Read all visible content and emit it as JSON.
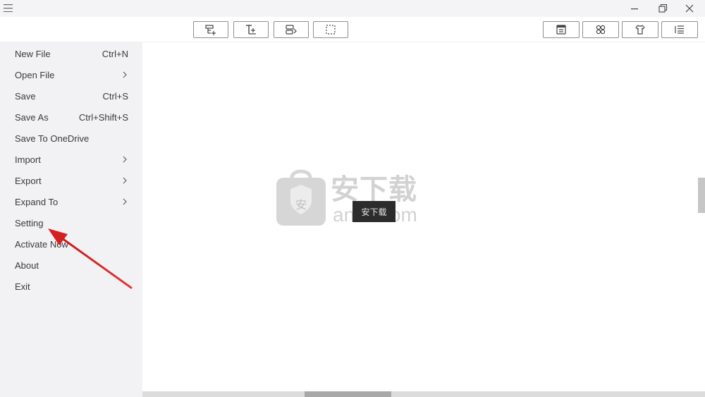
{
  "menu": {
    "items": [
      {
        "label": "New File",
        "shortcut": "Ctrl+N",
        "submenu": false
      },
      {
        "label": "Open File",
        "shortcut": "",
        "submenu": true
      },
      {
        "label": "Save",
        "shortcut": "Ctrl+S",
        "submenu": false
      },
      {
        "label": "Save As",
        "shortcut": "Ctrl+Shift+S",
        "submenu": false
      },
      {
        "label": "Save To OneDrive",
        "shortcut": "",
        "submenu": false
      },
      {
        "label": "Import",
        "shortcut": "",
        "submenu": true
      },
      {
        "label": "Export",
        "shortcut": "",
        "submenu": true
      },
      {
        "label": "Expand To",
        "shortcut": "",
        "submenu": true
      },
      {
        "label": "Setting",
        "shortcut": "",
        "submenu": false
      },
      {
        "label": "Activate Now",
        "shortcut": "",
        "submenu": false
      },
      {
        "label": "About",
        "shortcut": "",
        "submenu": false
      },
      {
        "label": "Exit",
        "shortcut": "",
        "submenu": false
      }
    ]
  },
  "toolbar": {
    "left_icons": [
      "add-subtopic-icon",
      "add-topic-icon",
      "add-note-icon",
      "select-area-icon"
    ],
    "right_icons": [
      "layout-icon",
      "style-icon",
      "theme-icon",
      "outline-icon"
    ]
  },
  "watermark": {
    "title": "安下载",
    "domain": "anxz.com",
    "tag": "安下载",
    "badge": "安"
  },
  "colors": {
    "menu_bg": "#f2f2f5",
    "titlebar_bg": "#f4f4f6",
    "arrow": "#d42020",
    "button_border": "#8e8e95"
  }
}
